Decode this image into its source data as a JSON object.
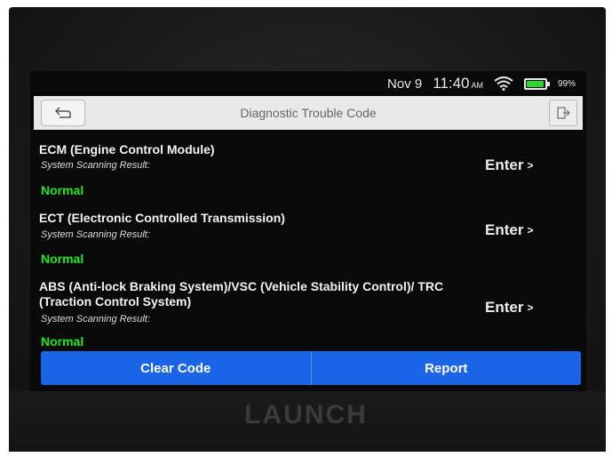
{
  "status_bar": {
    "date": "Nov 9",
    "time": "11:40",
    "ampm": "AM",
    "battery": "99%"
  },
  "header": {
    "title": "Diagnostic Trouble Code"
  },
  "result_label": "System Scanning Result:",
  "enter_label": "Enter",
  "systems": [
    {
      "name": "ECM (Engine Control Module)",
      "status": "Normal"
    },
    {
      "name": "ECT (Electronic Controlled Transmission)",
      "status": "Normal"
    },
    {
      "name": "ABS (Anti-lock Braking System)/VSC (Vehicle Stability Control)/ TRC (Traction Control System)",
      "status": "Normal"
    }
  ],
  "footer": {
    "clear_code": "Clear Code",
    "report": "Report"
  },
  "device": {
    "brand": "LAUNCH"
  },
  "colors": {
    "accent_blue": "#1a64e8",
    "status_normal": "#22e81d"
  }
}
